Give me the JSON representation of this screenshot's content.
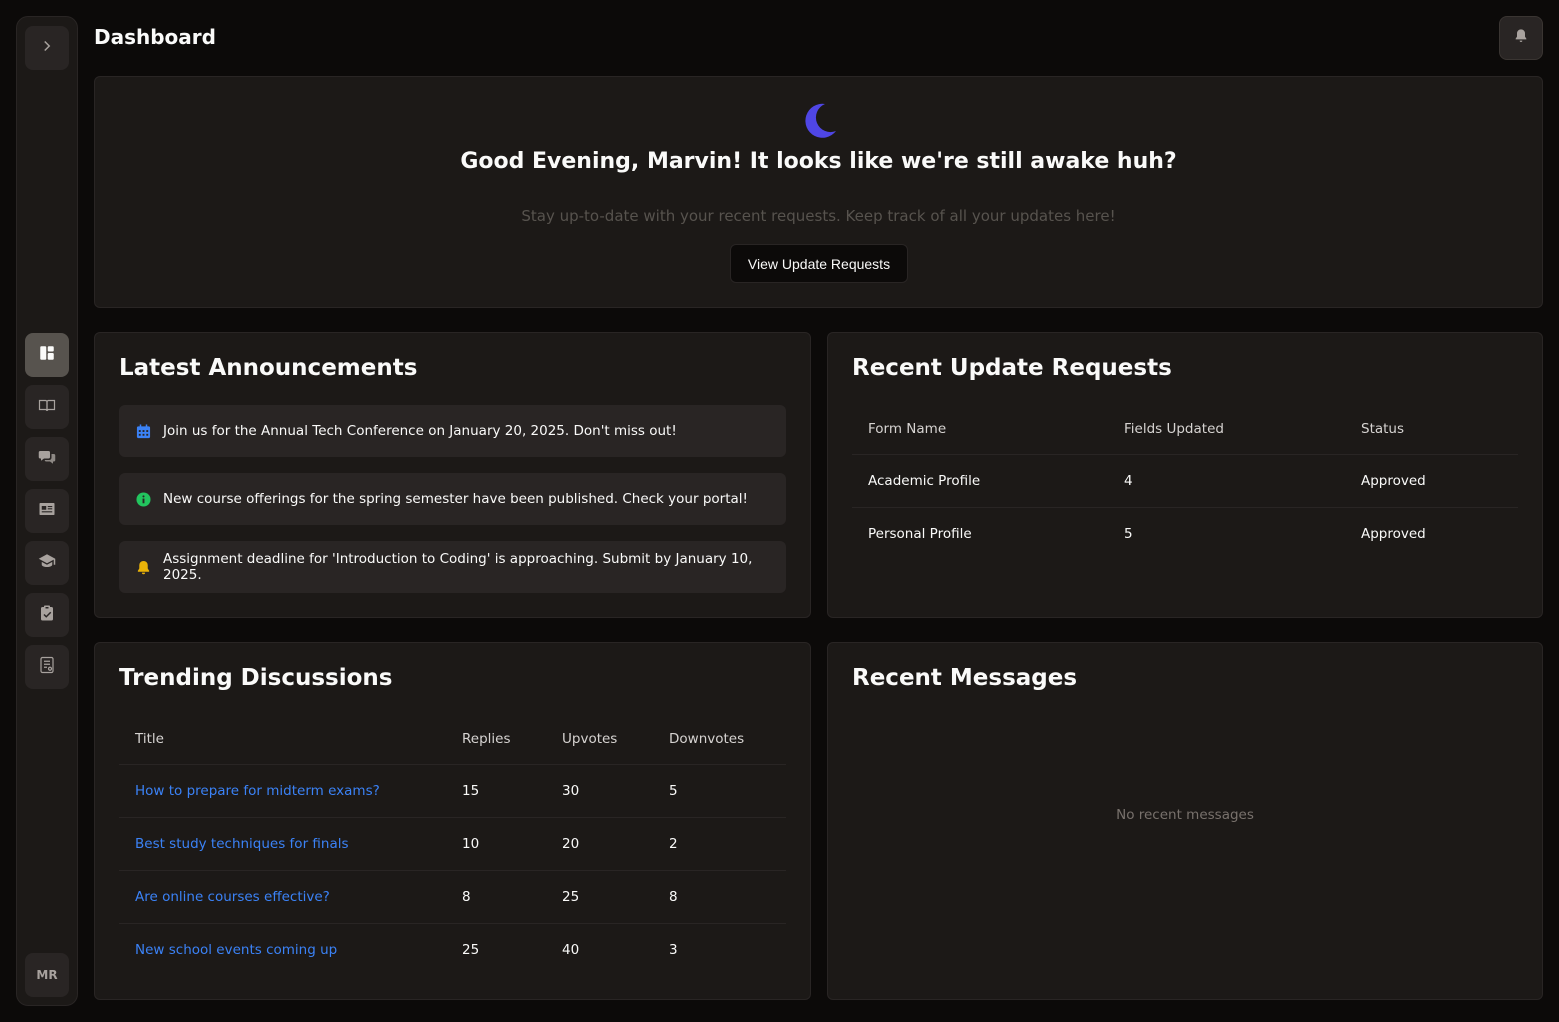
{
  "header": {
    "title": "Dashboard"
  },
  "sidebar": {
    "expand_icon": "chevron-right-icon",
    "items": [
      {
        "icon": "dashboard-icon",
        "active": true
      },
      {
        "icon": "book-open-icon",
        "active": false
      },
      {
        "icon": "chat-bubbles-icon",
        "active": false
      },
      {
        "icon": "id-card-icon",
        "active": false
      },
      {
        "icon": "graduation-cap-icon",
        "active": false
      },
      {
        "icon": "clipboard-check-icon",
        "active": false
      },
      {
        "icon": "document-list-icon",
        "active": false
      }
    ],
    "avatar_initials": "MR"
  },
  "hero": {
    "title": "Good Evening, Marvin! It looks like we're still awake huh?",
    "subtitle": "Stay up-to-date with your recent requests. Keep track of all your updates here!",
    "button_label": "View Update Requests",
    "moon_color": "#4f46e5"
  },
  "announcements": {
    "title": "Latest Announcements",
    "items": [
      {
        "icon": "calendar-icon",
        "color": "#3b82f6",
        "text": "Join us for the Annual Tech Conference on January 20, 2025. Don't miss out!"
      },
      {
        "icon": "info-icon",
        "color": "#22c55e",
        "text": "New course offerings for the spring semester have been published. Check your portal!"
      },
      {
        "icon": "bell-icon",
        "color": "#eab308",
        "text": "Assignment deadline for 'Introduction to Coding' is approaching. Submit by January 10, 2025."
      }
    ]
  },
  "requests": {
    "title": "Recent Update Requests",
    "columns": [
      "Form Name",
      "Fields Updated",
      "Status"
    ],
    "rows": [
      [
        "Academic Profile",
        "4",
        "Approved"
      ],
      [
        "Personal Profile",
        "5",
        "Approved"
      ]
    ]
  },
  "discussions": {
    "title": "Trending Discussions",
    "columns": [
      "Title",
      "Replies",
      "Upvotes",
      "Downvotes"
    ],
    "rows": [
      [
        "How to prepare for midterm exams?",
        "15",
        "30",
        "5"
      ],
      [
        "Best study techniques for finals",
        "10",
        "20",
        "2"
      ],
      [
        "Are online courses effective?",
        "8",
        "25",
        "8"
      ],
      [
        "New school events coming up",
        "25",
        "40",
        "3"
      ]
    ]
  },
  "messages": {
    "title": "Recent Messages",
    "empty_text": "No recent messages"
  }
}
